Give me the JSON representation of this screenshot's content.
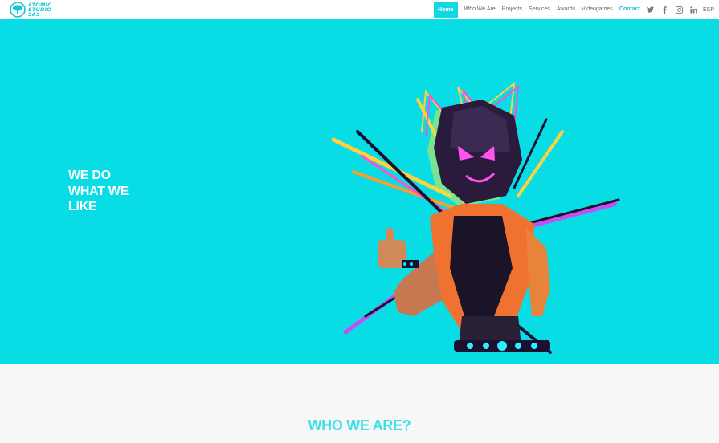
{
  "brand": {
    "logo_lines": [
      "ATOMIC",
      "STUDIO",
      "SAS"
    ],
    "accent_color": "#10d9e3",
    "hero_bg_color": "#08dde5"
  },
  "nav": {
    "items": [
      {
        "label": "Home",
        "active": true
      },
      {
        "label": "Who We Are"
      },
      {
        "label": "Projects"
      },
      {
        "label": "Services"
      },
      {
        "label": "Awards"
      },
      {
        "label": "Videogames"
      },
      {
        "label": "Contact",
        "highlight": true
      }
    ],
    "social_icons": [
      "twitter-icon",
      "facebook-icon",
      "instagram-icon",
      "linkedin-icon"
    ],
    "language": "ESP"
  },
  "hero": {
    "headline_lines": [
      "WE DO",
      "WHAT WE",
      "LIKE"
    ],
    "artwork": "low-poly-masked-character-thumbs-up"
  },
  "about": {
    "title": "WHO WE ARE?"
  }
}
